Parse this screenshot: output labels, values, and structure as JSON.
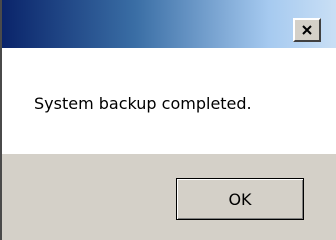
{
  "dialog": {
    "message": "System backup completed.",
    "ok_label": "OK",
    "close_icon": "close-icon"
  },
  "colors": {
    "title_gradient_start": "#0a246a",
    "title_gradient_end": "#c9dff5",
    "footer_background": "#d4d0c8",
    "content_background": "#ffffff"
  }
}
